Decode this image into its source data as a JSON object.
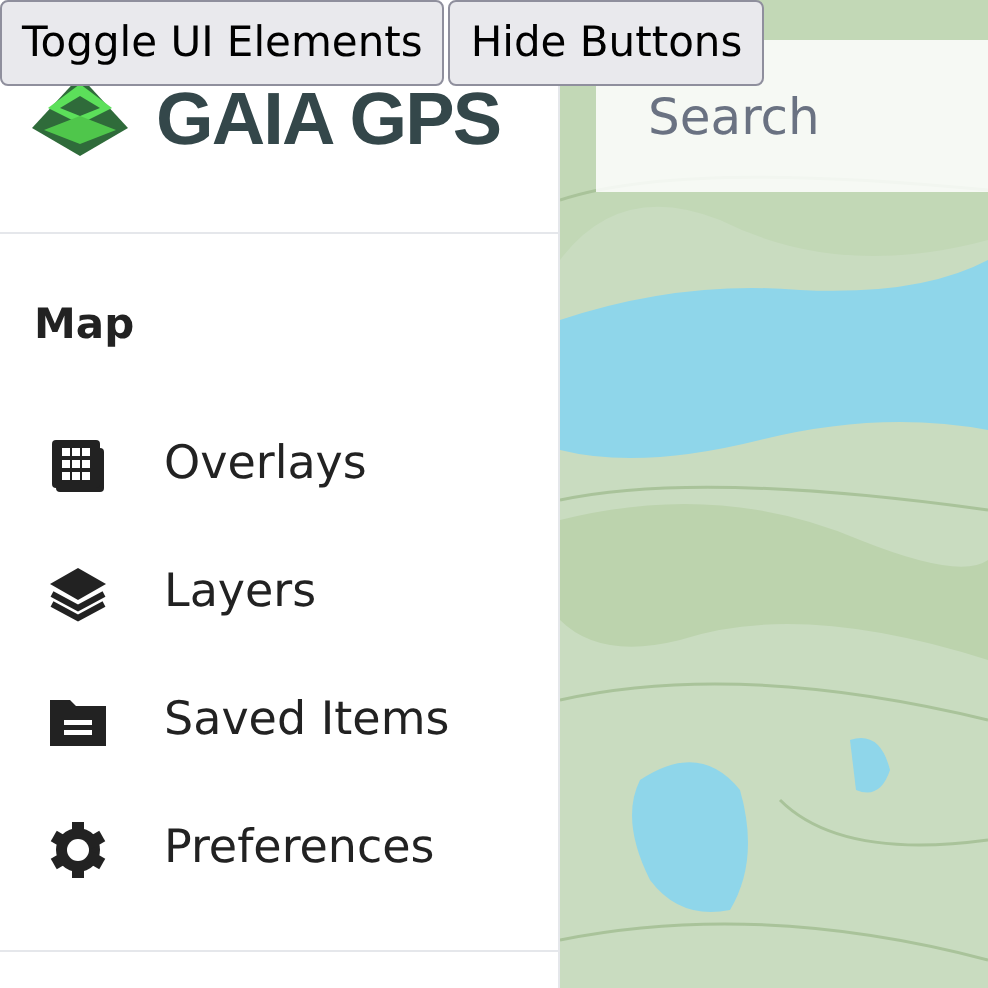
{
  "debug_buttons": [
    "Toggle UI Elements",
    "Hide Buttons"
  ],
  "logo": {
    "text": "GAIA GPS"
  },
  "section": {
    "title": "Map"
  },
  "menu": [
    {
      "label": "Overlays"
    },
    {
      "label": "Layers"
    },
    {
      "label": "Saved Items"
    },
    {
      "label": "Preferences"
    }
  ],
  "search": {
    "placeholder": "Search"
  }
}
